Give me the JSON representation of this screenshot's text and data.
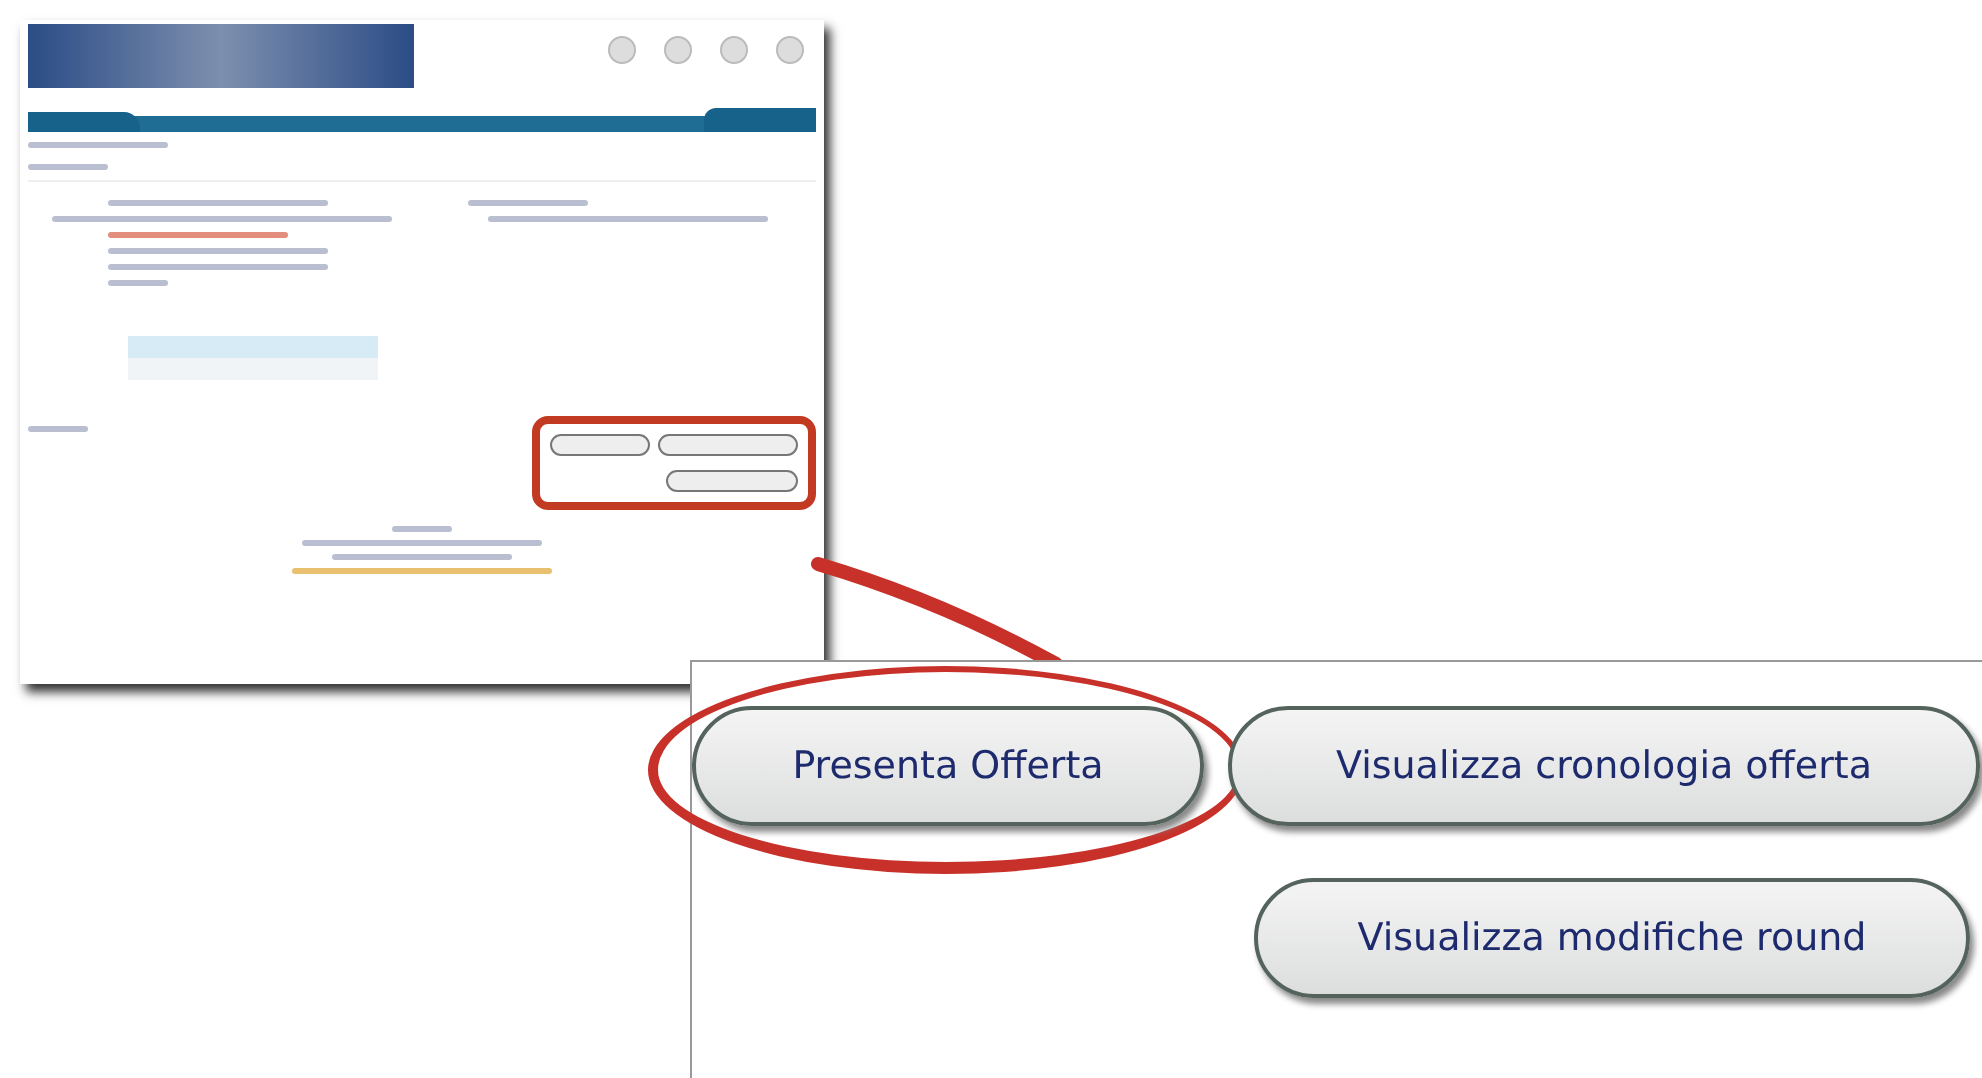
{
  "callout": {
    "button_rows": [
      [
        {
          "label": "Presenta Offerta",
          "highlighted": true
        },
        {
          "label": "Visualizza cronologia offerta",
          "highlighted": false
        }
      ],
      [
        {
          "label": "Visualizza modifiche round",
          "highlighted": false
        }
      ]
    ]
  }
}
